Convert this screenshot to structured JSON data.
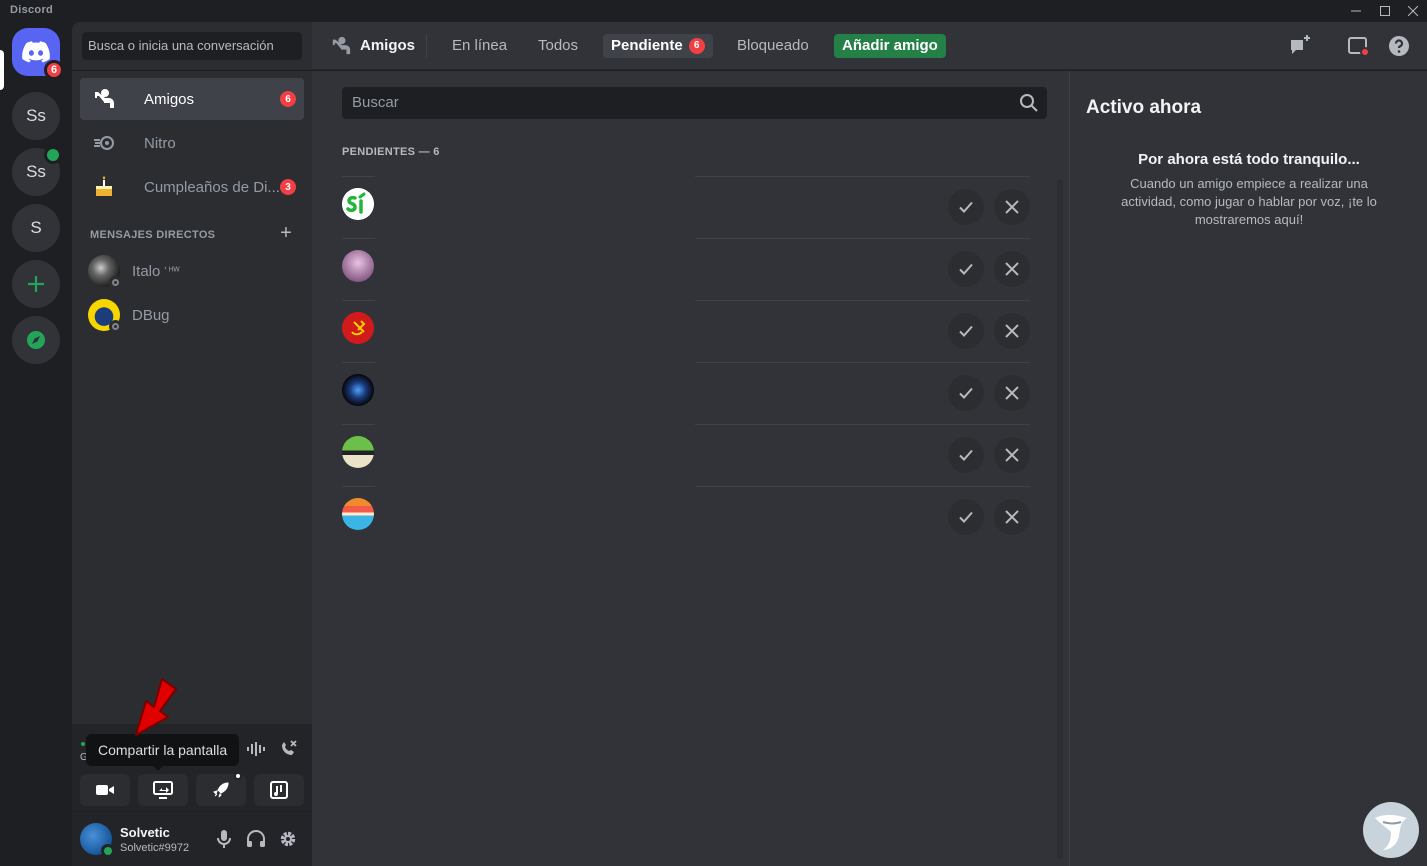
{
  "window": {
    "title": "Discord"
  },
  "servers": {
    "home_badge": "6",
    "items": [
      {
        "label": "Ss"
      },
      {
        "label": "Ss"
      },
      {
        "label": "S"
      }
    ]
  },
  "dm": {
    "search_placeholder": "Busca o inicia una conversación",
    "nav": [
      {
        "label": "Amigos",
        "badge": "6"
      },
      {
        "label": "Nitro"
      },
      {
        "label": "Cumpleaños de Di...",
        "badge": "3"
      }
    ],
    "heading": "MENSAJES DIRECTOS",
    "users": [
      {
        "name": "Italo",
        "suffix": "' ᴴᵂ"
      },
      {
        "name": "DBug"
      }
    ]
  },
  "voice": {
    "tooltip": "Compartir la pantalla",
    "partial_label": "G"
  },
  "user": {
    "name": "Solvetic",
    "tag": "Solvetic#9972"
  },
  "header": {
    "title": "Amigos",
    "tabs": [
      {
        "label": "En línea"
      },
      {
        "label": "Todos"
      },
      {
        "label": "Pendiente",
        "badge": "6"
      },
      {
        "label": "Bloqueado"
      }
    ],
    "add_friend": "Añadir amigo"
  },
  "main": {
    "search_placeholder": "Buscar",
    "pending_heading": "PENDIENTES — 6",
    "pending": [
      {
        "avatar": "si"
      },
      {
        "avatar": "pink"
      },
      {
        "avatar": "red"
      },
      {
        "avatar": "dark"
      },
      {
        "avatar": "mushroom"
      },
      {
        "avatar": "stripes"
      }
    ]
  },
  "active_now": {
    "title": "Activo ahora",
    "quiet_title": "Por ahora está todo tranquilo...",
    "quiet_desc": "Cuando un amigo empiece a realizar una actividad, como jugar o hablar por voz, ¡te lo mostraremos aquí!"
  },
  "colors": {
    "blurple": "#5865f2",
    "green": "#248046",
    "red": "#f23f43",
    "online": "#23a559"
  }
}
